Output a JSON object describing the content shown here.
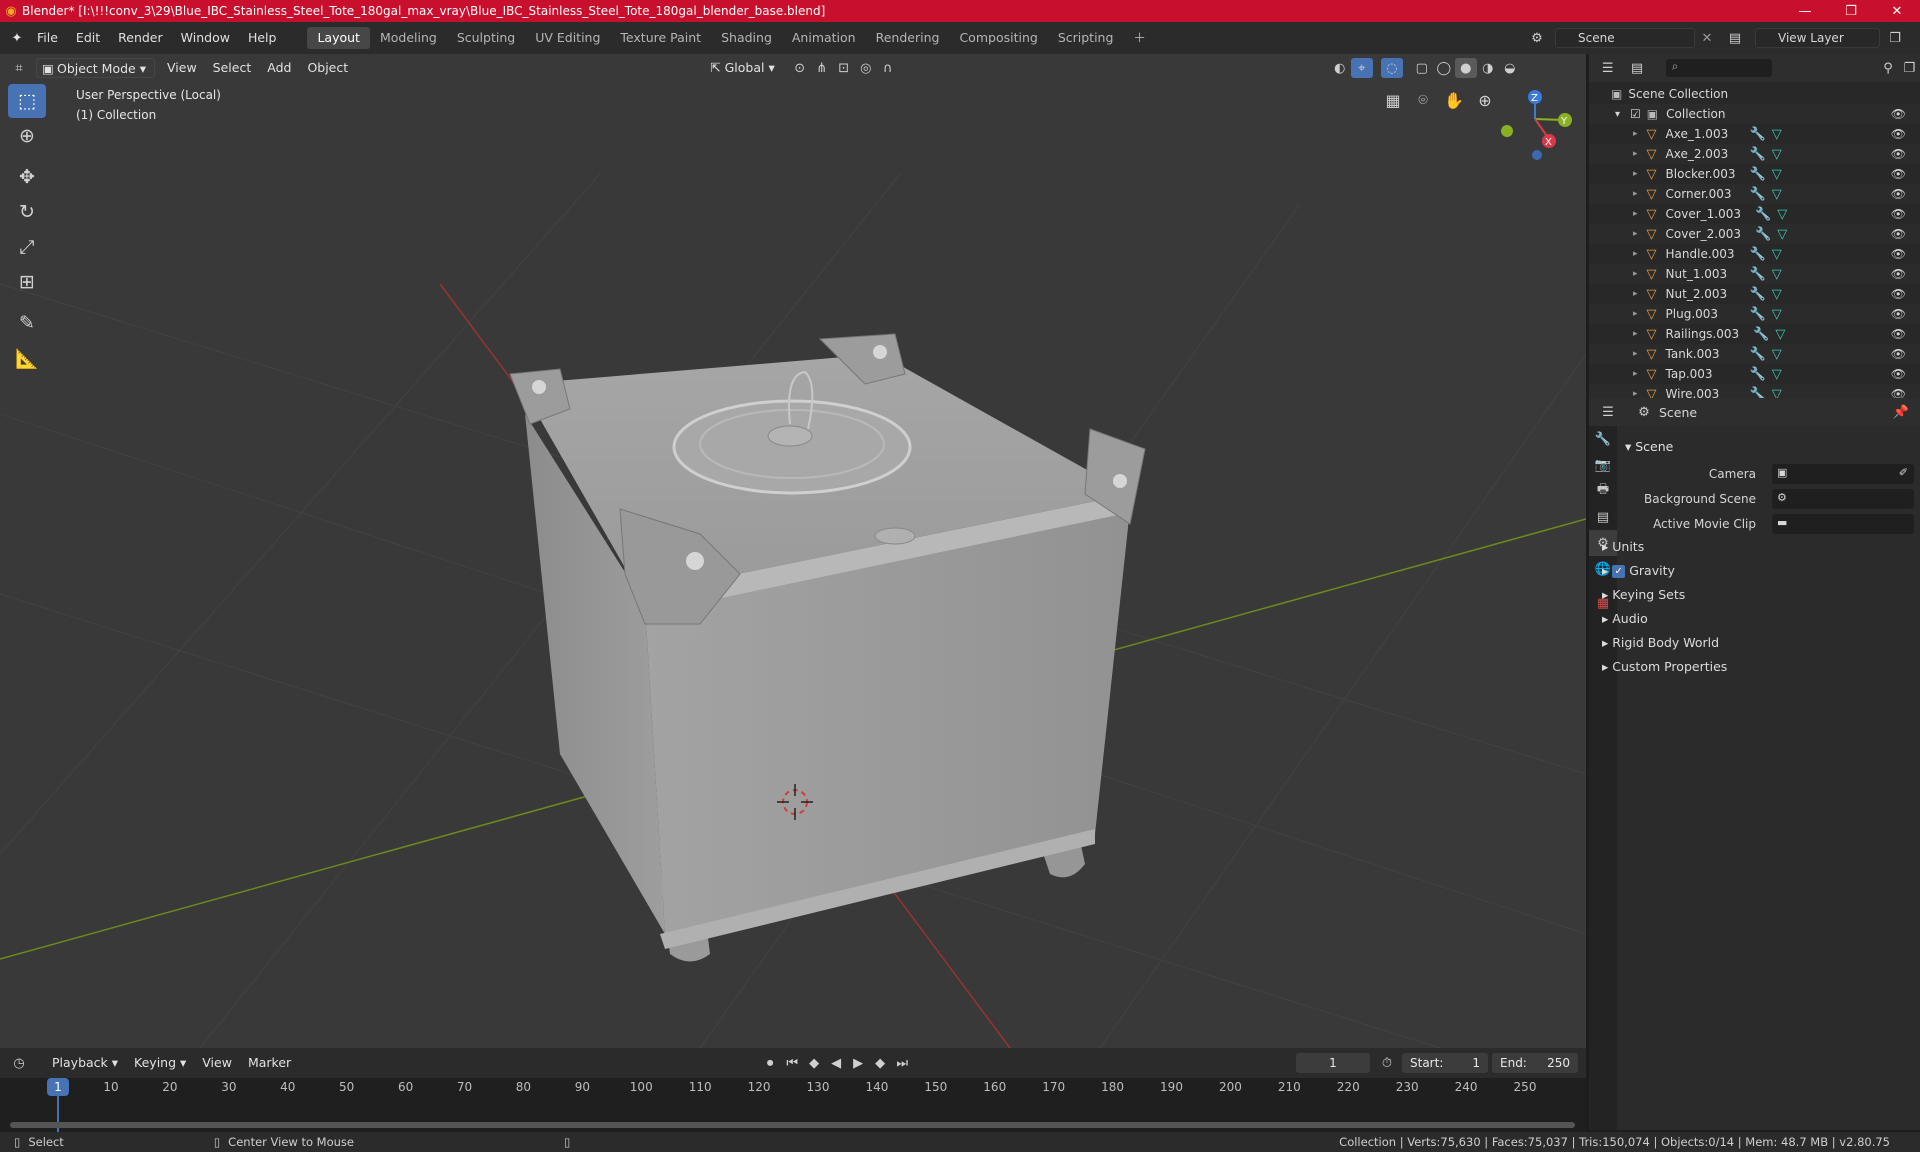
{
  "window": {
    "title": "Blender* [I:\\!!!conv_3\\29\\Blue_IBC_Stainless_Steel_Tote_180gal_max_vray\\Blue_IBC_Stainless_Steel_Tote_180gal_blender_base.blend]",
    "controls": [
      "—",
      "❐",
      "✕"
    ]
  },
  "menu": [
    "File",
    "Edit",
    "Render",
    "Window",
    "Help"
  ],
  "workspaces": [
    "Layout",
    "Modeling",
    "Sculpting",
    "UV Editing",
    "Texture Paint",
    "Shading",
    "Animation",
    "Rendering",
    "Compositing",
    "Scripting"
  ],
  "scene_selector": "Scene",
  "view_layer": "View Layer",
  "viewport_header": {
    "mode": "Object Mode",
    "menus": [
      "View",
      "Select",
      "Add",
      "Object"
    ],
    "orientation": "Global"
  },
  "viewport": {
    "perspective": "User Perspective (Local)",
    "collection": "(1) Collection",
    "gizmo": {
      "z": "Z",
      "y": "Y",
      "x": "X"
    }
  },
  "outliner": {
    "root": "Scene Collection",
    "collection": "Collection",
    "objects": [
      "Axe_1.003",
      "Axe_2.003",
      "Blocker.003",
      "Corner.003",
      "Cover_1.003",
      "Cover_2.003",
      "Handle.003",
      "Nut_1.003",
      "Nut_2.003",
      "Plug.003",
      "Railings.003",
      "Tank.003",
      "Tap.003",
      "Wire.003"
    ]
  },
  "properties": {
    "header": "Scene",
    "panel": "Scene",
    "fields": [
      {
        "label": "Camera"
      },
      {
        "label": "Background Scene"
      },
      {
        "label": "Active Movie Clip"
      }
    ],
    "subpanels": [
      "Units",
      "Gravity",
      "Keying Sets",
      "Audio",
      "Rigid Body World",
      "Custom Properties"
    ]
  },
  "timeline": {
    "menus": [
      "Playback",
      "Keying",
      "View",
      "Marker"
    ],
    "current_frame": "1",
    "start_label": "Start:",
    "start": "1",
    "end_label": "End:",
    "end": "250",
    "ticks": [
      "1",
      "10",
      "20",
      "30",
      "40",
      "50",
      "60",
      "70",
      "80",
      "90",
      "100",
      "110",
      "120",
      "130",
      "140",
      "150",
      "160",
      "170",
      "180",
      "190",
      "200",
      "210",
      "220",
      "230",
      "240",
      "250"
    ]
  },
  "status": {
    "select": "Select",
    "center": "Center View to Mouse",
    "stats": "Collection | Verts:75,630 | Faces:75,037 | Tris:150,074 | Objects:0/14 | Mem: 48.7 MB | v2.80.75"
  }
}
